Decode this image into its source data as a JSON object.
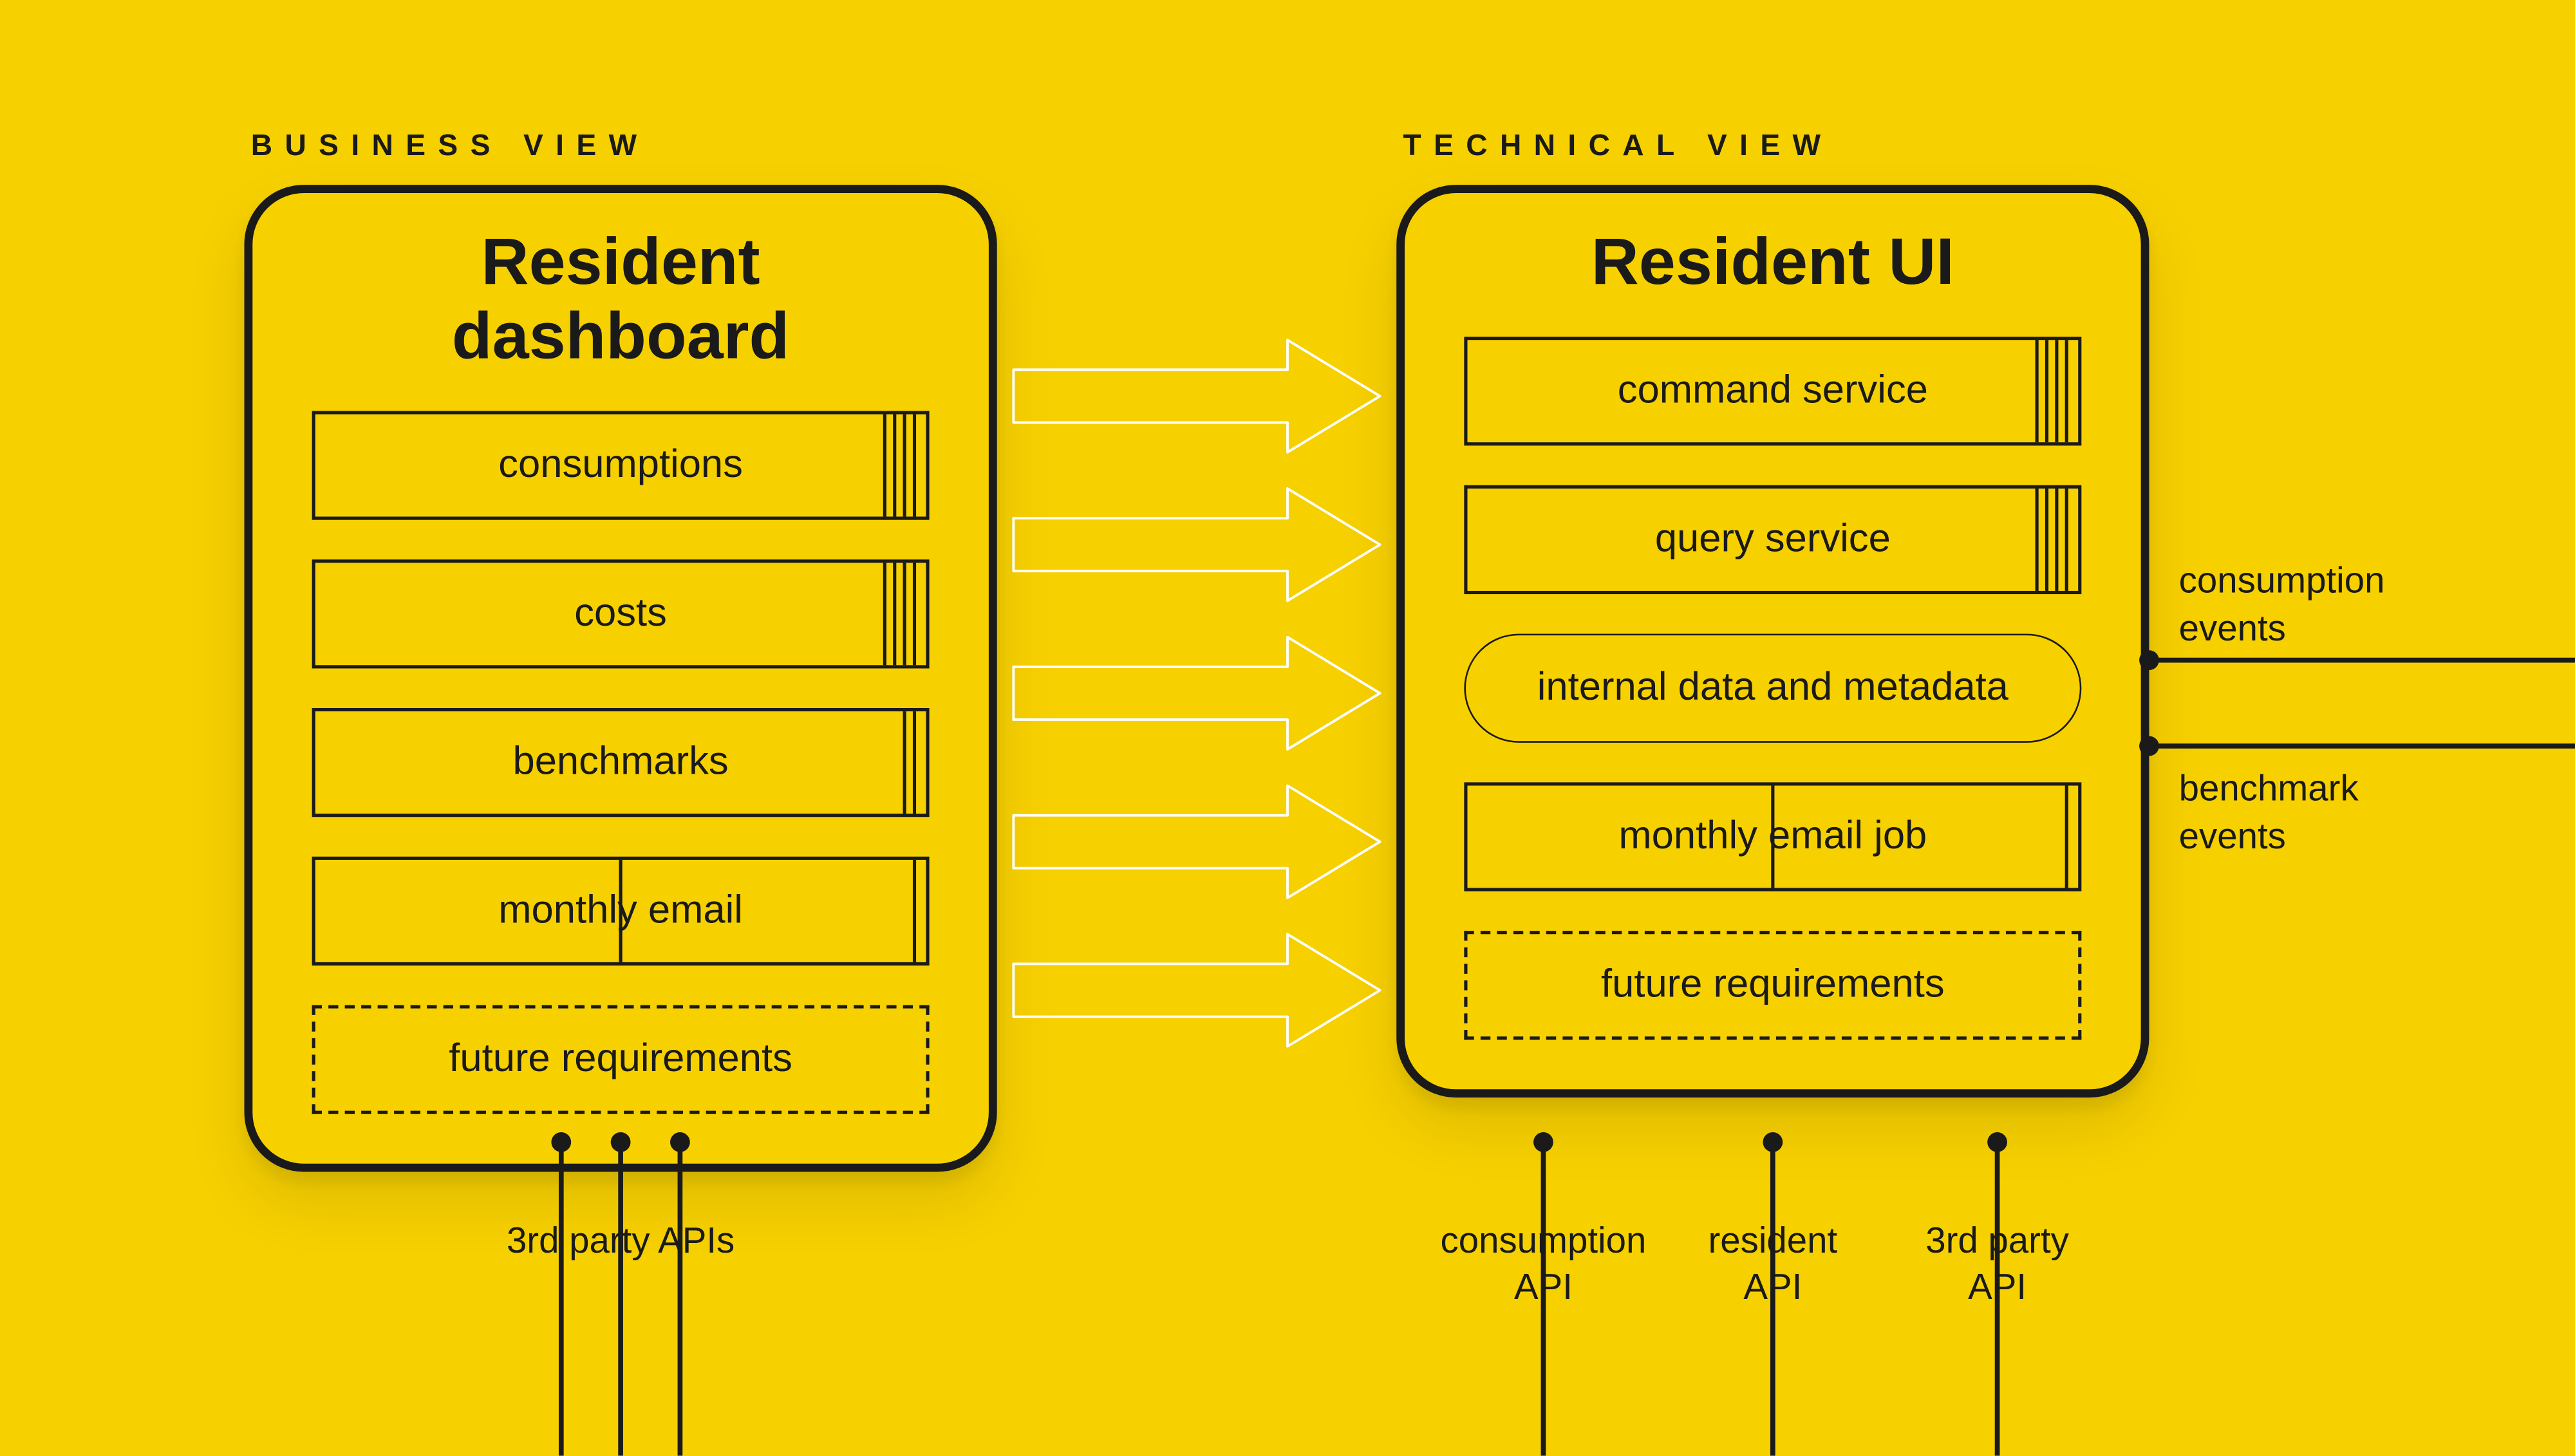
{
  "sections": {
    "business": "BUSINESS VIEW",
    "technical": "TECHNICAL VIEW"
  },
  "business_panel": {
    "title": "Resident dashboard",
    "items": [
      {
        "label": "consumptions",
        "style": "stack5"
      },
      {
        "label": "costs",
        "style": "stack5"
      },
      {
        "label": "benchmarks",
        "style": "stack3"
      },
      {
        "label": "monthly email",
        "style": "stack2"
      },
      {
        "label": "future requirements",
        "style": "dashed"
      }
    ]
  },
  "technical_panel": {
    "title": "Resident UI",
    "items": [
      {
        "label": "command service",
        "style": "stack5"
      },
      {
        "label": "query service",
        "style": "stack5"
      },
      {
        "label": "internal data and metadata",
        "style": "pill"
      },
      {
        "label": "monthly email job",
        "style": "stack2"
      },
      {
        "label": "future requirements",
        "style": "dashed"
      }
    ]
  },
  "bottom_apis": {
    "business": {
      "group_label": "3rd party APIs"
    },
    "technical": {
      "items": [
        {
          "label_line1": "consumption",
          "label_line2": "API"
        },
        {
          "label_line1": "resident",
          "label_line2": "API"
        },
        {
          "label_line1": "3rd party",
          "label_line2": "API"
        }
      ]
    }
  },
  "side_events": {
    "top": {
      "line1": "consumption",
      "line2": "events"
    },
    "bottom": {
      "line1": "benchmark",
      "line2": "events"
    }
  }
}
